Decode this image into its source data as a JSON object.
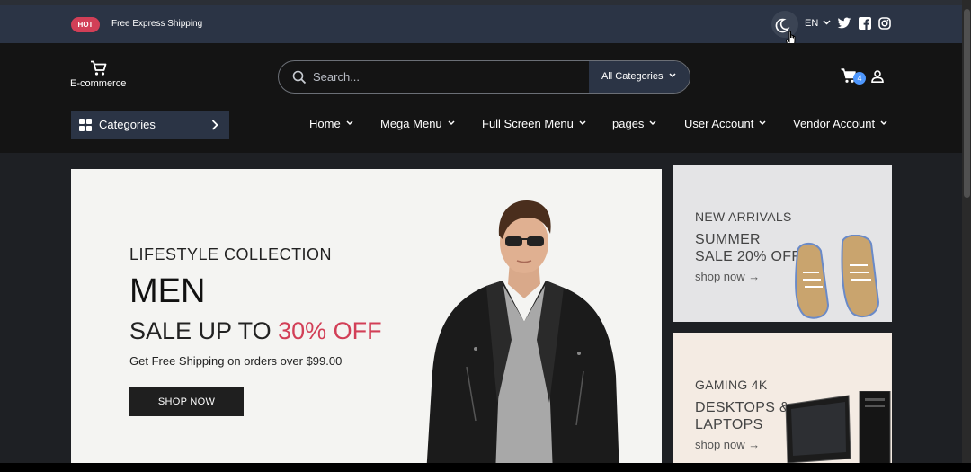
{
  "topbar": {
    "badge": "HOT",
    "promo_text": "Free Express Shipping",
    "language": "EN",
    "icons": [
      "moon-icon",
      "twitter-icon",
      "facebook-icon",
      "instagram-icon"
    ]
  },
  "header": {
    "logo_text": "E-commerce",
    "search_placeholder": "Search...",
    "category_select": "All Categories",
    "cart_count": "4"
  },
  "nav": {
    "categories_label": "Categories",
    "items": [
      "Home",
      "Mega Menu",
      "Full Screen Menu",
      "pages",
      "User Account",
      "Vendor Account"
    ]
  },
  "hero": {
    "kicker": "LIFESTYLE COLLECTION",
    "title": "MEN",
    "sale_prefix": "SALE UP TO",
    "sale_percent": "30% OFF",
    "shipping": "Get Free Shipping on orders over $99.00",
    "button": "SHOP NOW"
  },
  "promos": [
    {
      "kicker": "NEW ARRIVALS",
      "title_line1": "SUMMER",
      "title_line2": "SALE 20% OFF",
      "link": "shop now →"
    },
    {
      "kicker": "GAMING 4K",
      "title_line1": "DESKTOPS &",
      "title_line2": "LAPTOPS",
      "link": "shop now →"
    }
  ],
  "colors": {
    "accent": "#d23f57",
    "topbar_bg": "#2b3445",
    "header_bg": "#141414",
    "badge_blue": "#4e97fd"
  }
}
